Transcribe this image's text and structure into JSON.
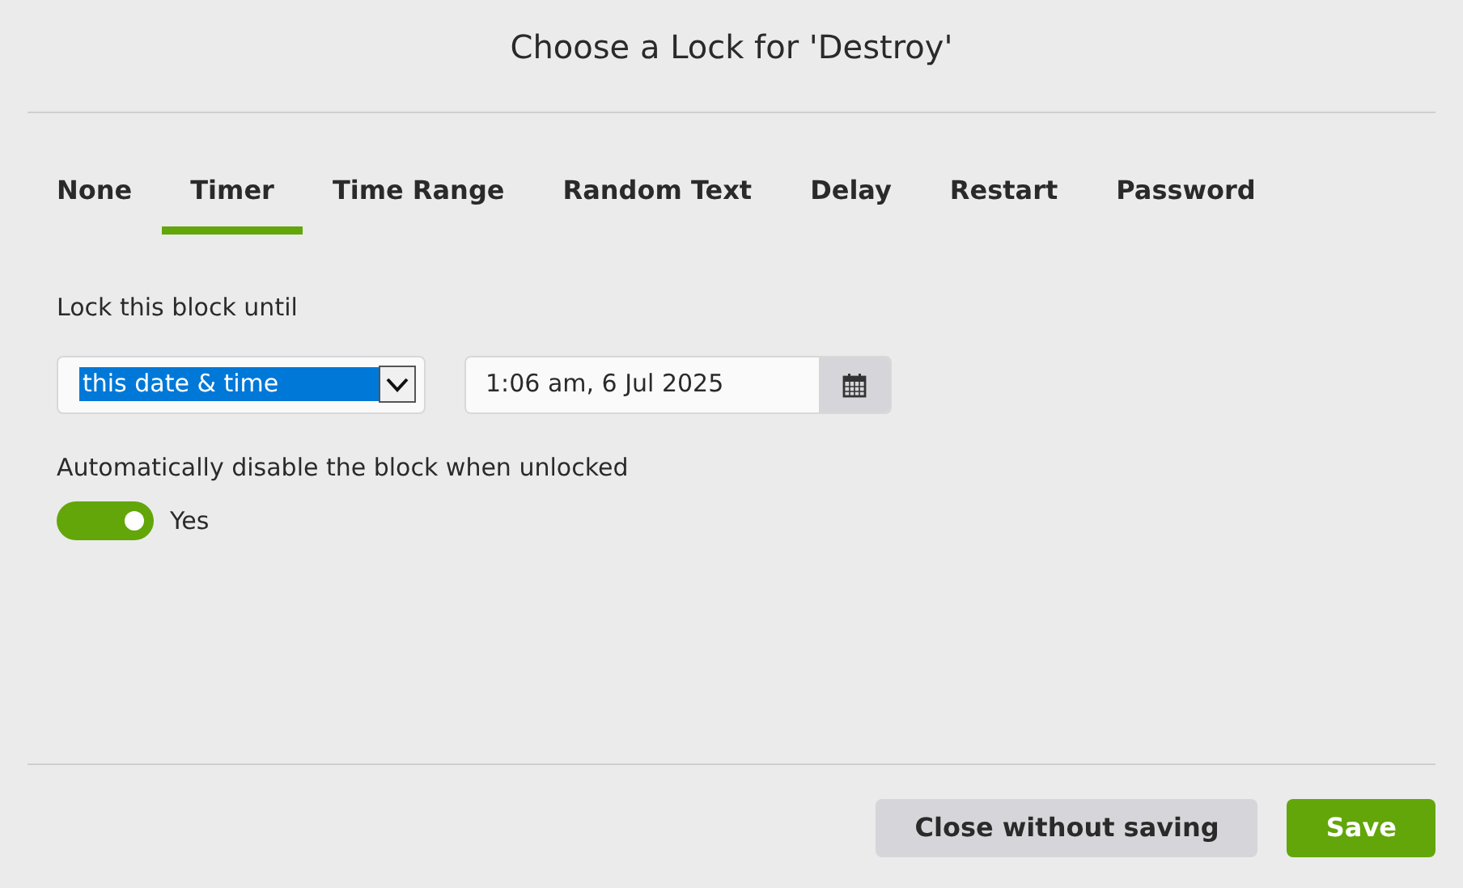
{
  "dialog": {
    "title": "Choose a Lock for 'Destroy'"
  },
  "tabs": [
    {
      "label": "None",
      "selected": false
    },
    {
      "label": "Timer",
      "selected": true
    },
    {
      "label": "Time Range",
      "selected": false
    },
    {
      "label": "Random Text",
      "selected": false
    },
    {
      "label": "Delay",
      "selected": false
    },
    {
      "label": "Restart",
      "selected": false
    },
    {
      "label": "Password",
      "selected": false
    }
  ],
  "lock_label": "Lock this block until",
  "mode_select": {
    "value": "this date & time",
    "highlighted": true
  },
  "date_field": {
    "value": "1:06 am, 6 Jul 2025"
  },
  "auto_disable": {
    "label": "Automatically disable the block when unlocked",
    "on": true,
    "state_label": "Yes"
  },
  "buttons": [
    {
      "label": "Close without saving",
      "kind": "secondary"
    },
    {
      "label": "Save",
      "kind": "primary"
    }
  ]
}
